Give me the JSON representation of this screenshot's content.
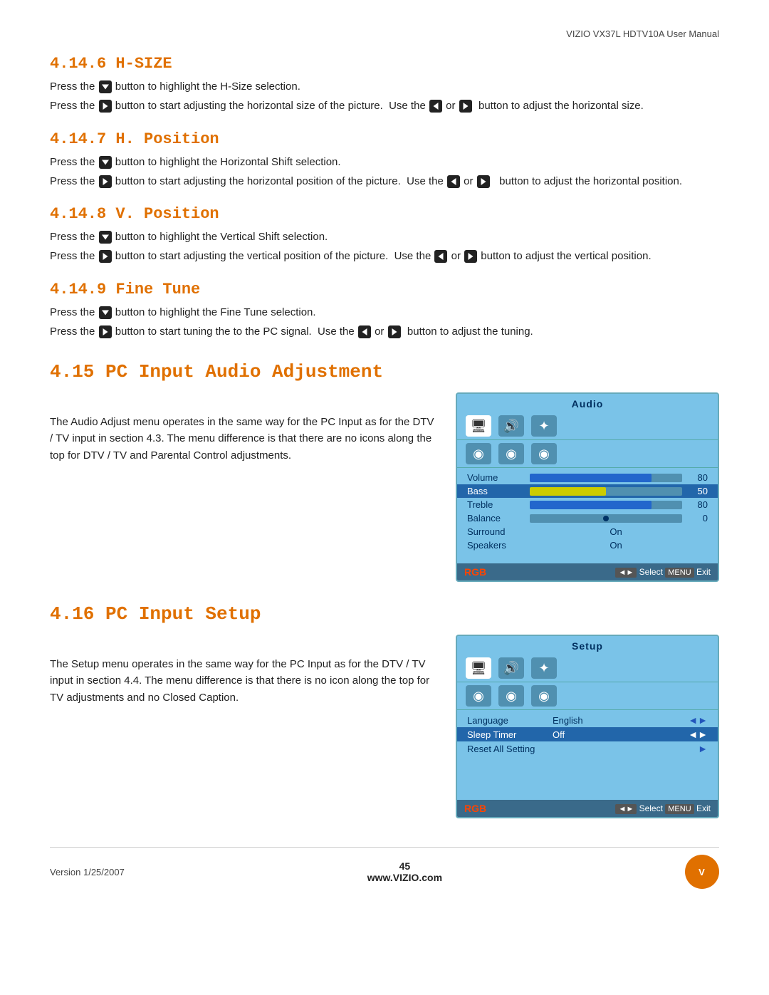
{
  "header": {
    "title": "VIZIO VX37L HDTV10A User Manual"
  },
  "sections": {
    "h_size": {
      "heading": "4.14.6 H-SIZE",
      "line1": "Press the  button to highlight the H-Size selection.",
      "line2": "Press the  button to start adjusting the horizontal size of the picture.  Use the  or   button to adjust the horizontal size."
    },
    "h_position": {
      "heading": "4.14.7 H. Position",
      "line1": "Press the  button to highlight the Horizontal Shift selection.",
      "line2": "Press the  button to start adjusting the horizontal position of the picture.  Use the  or   button to adjust the horizontal position."
    },
    "v_position": {
      "heading": "4.14.8 V. Position",
      "line1": "Press the  button to highlight the Vertical Shift selection.",
      "line2": "Press the  button to start adjusting the vertical position of the picture.  Use the  or  button to adjust the vertical position."
    },
    "fine_tune": {
      "heading": "4.14.9 Fine Tune",
      "line1": "Press the  button to highlight the Fine Tune selection.",
      "line2": "Press the  button to start tuning the to the PC signal.  Use the  or   button to adjust the tuning."
    },
    "pc_audio": {
      "heading": "4.15 PC Input Audio Adjustment",
      "description": "The Audio Adjust menu operates in the same way for the PC Input as for the DTV / TV input in section 4.3.  The menu difference is that there are no icons along the top for DTV / TV and Parental Control adjustments.",
      "menu_title": "Audio",
      "menu_items": [
        {
          "label": "Volume",
          "type": "bar",
          "color": "#2266cc",
          "pct": 80,
          "value": "80"
        },
        {
          "label": "Bass",
          "type": "bar",
          "color": "#cccc00",
          "pct": 50,
          "value": "50",
          "highlighted": true
        },
        {
          "label": "Treble",
          "type": "bar",
          "color": "#2266cc",
          "pct": 80,
          "value": "80"
        },
        {
          "label": "Balance",
          "type": "dot",
          "value": "0"
        },
        {
          "label": "Surround",
          "type": "text",
          "value": "On"
        },
        {
          "label": "Speakers",
          "type": "text",
          "value": "On"
        }
      ],
      "footer_rgb": "RGB",
      "footer_hint": "◄► Select  MENU  Exit"
    },
    "pc_setup": {
      "heading": "4.16 PC Input Setup",
      "description": "The Setup menu operates in the same way for the PC Input as for the DTV / TV input in section 4.4.  The menu difference is that there is no icon along the top for TV adjustments and no Closed Caption.",
      "menu_title": "Setup",
      "menu_items": [
        {
          "label": "Language",
          "value": "English",
          "arrow": "◄►",
          "highlighted": false
        },
        {
          "label": "Sleep Timer",
          "value": "Off",
          "arrow": "◄►",
          "highlighted": true
        },
        {
          "label": "Reset All Setting",
          "value": "",
          "arrow": "►",
          "highlighted": false
        }
      ],
      "footer_rgb": "RGB",
      "footer_hint": "◄► Select  MENU  Exit"
    }
  },
  "footer": {
    "version": "Version 1/25/2007",
    "page": "45",
    "website": "www.VIZIO.com",
    "logo_text": "V"
  }
}
